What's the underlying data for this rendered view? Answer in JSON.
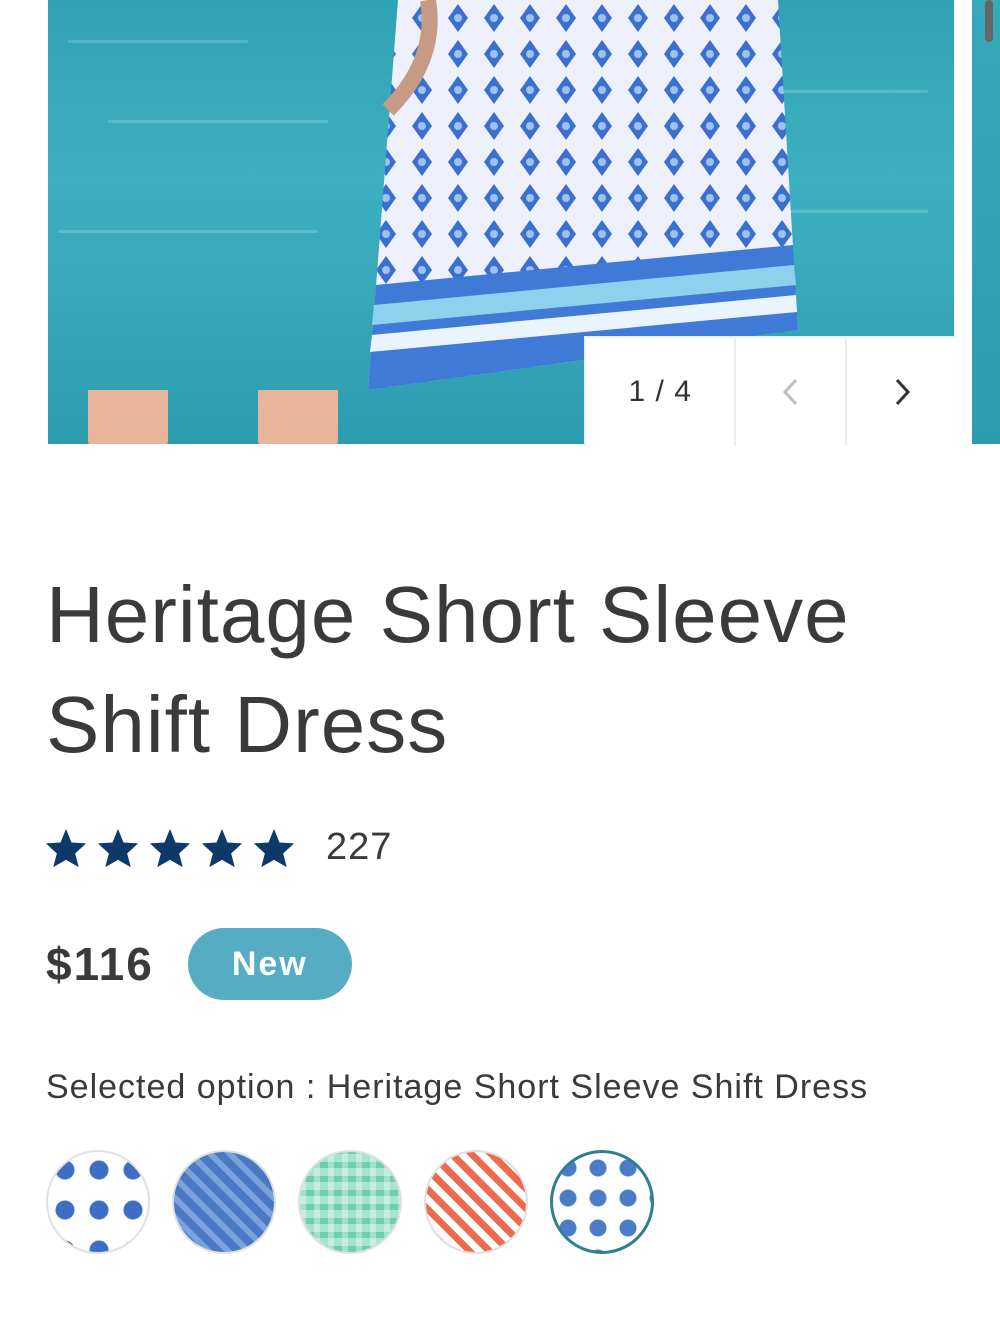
{
  "gallery": {
    "counter": "1 / 4",
    "prev_icon": "chevron-left-icon",
    "next_icon": "chevron-right-icon"
  },
  "product": {
    "title": "Heritage Short Sleeve Shift Dress",
    "rating": {
      "stars": 5,
      "star_color": "#0d3a6b",
      "count": "227"
    },
    "price": "$116",
    "badge": "New",
    "badge_color": "#56adc3",
    "selected_option": "Selected option : Heritage Short Sleeve Shift Dress"
  },
  "swatches": [
    {
      "name": "blue-paisley-drops",
      "selected": false
    },
    {
      "name": "blue-medallion",
      "selected": false
    },
    {
      "name": "green-lattice",
      "selected": false
    },
    {
      "name": "coral-ikat",
      "selected": false
    },
    {
      "name": "heritage-blue-floral",
      "selected": true
    }
  ]
}
